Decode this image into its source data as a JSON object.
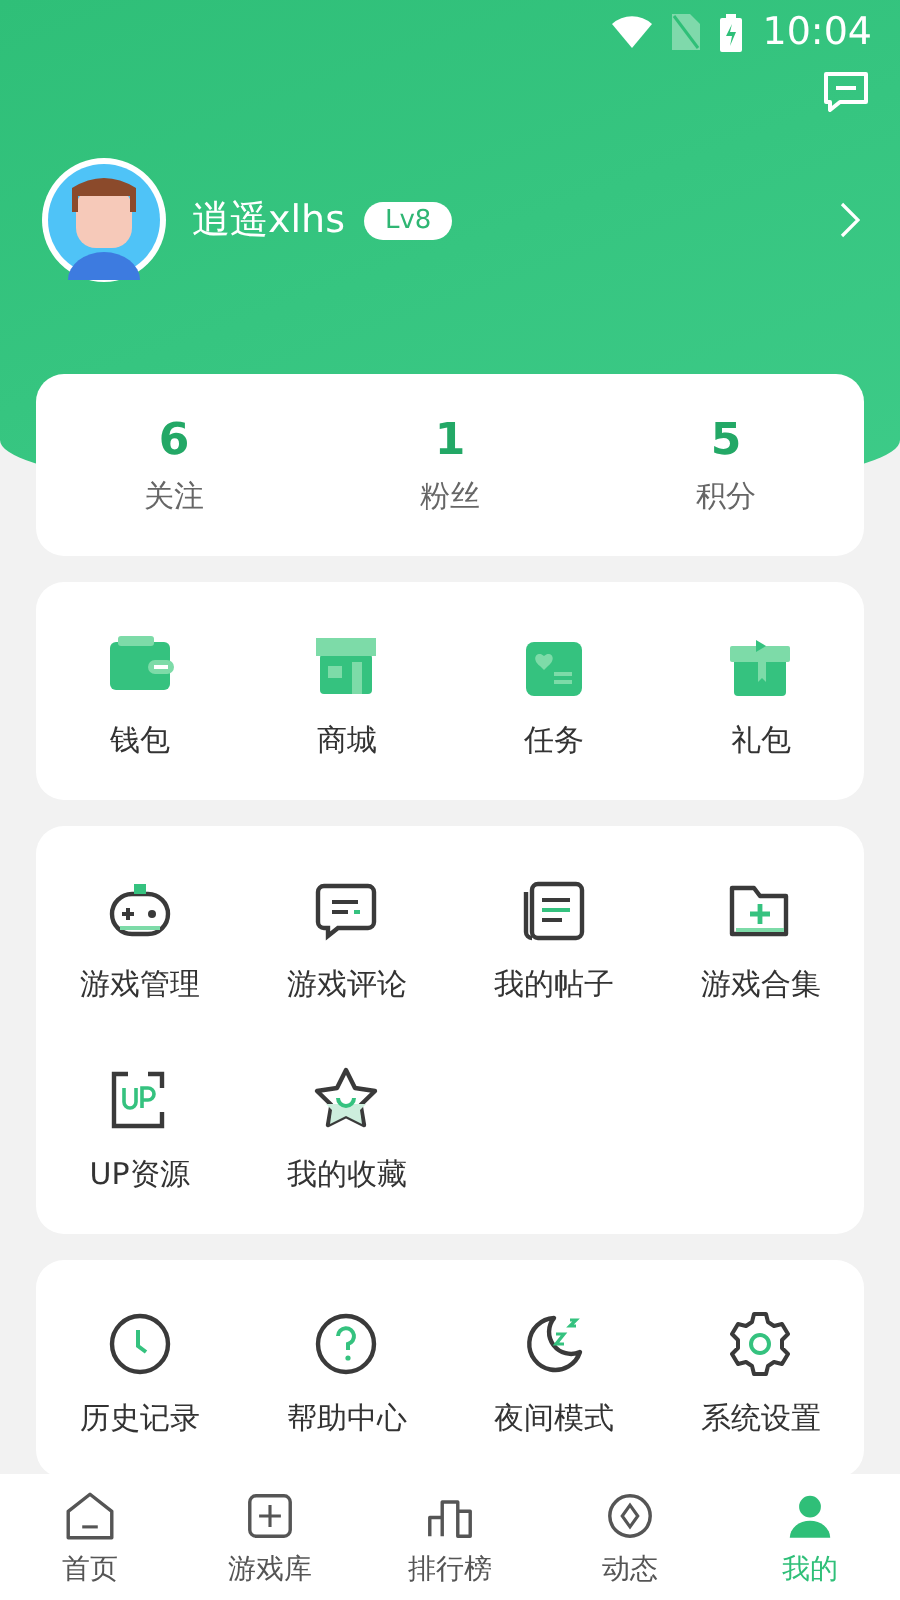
{
  "status_bar": {
    "time": "10:04"
  },
  "profile": {
    "name": "逍遥xlhs",
    "level": "Lv8"
  },
  "stats": [
    {
      "value": "6",
      "label": "关注"
    },
    {
      "value": "1",
      "label": "粉丝"
    },
    {
      "value": "5",
      "label": "积分"
    }
  ],
  "assets": [
    {
      "kind": "wallet",
      "label": "钱包"
    },
    {
      "kind": "shop",
      "label": "商城"
    },
    {
      "kind": "task",
      "label": "任务"
    },
    {
      "kind": "gift",
      "label": "礼包"
    }
  ],
  "tools": [
    {
      "kind": "gamepad",
      "label": "游戏管理"
    },
    {
      "kind": "comment",
      "label": "游戏评论"
    },
    {
      "kind": "post",
      "label": "我的帖子"
    },
    {
      "kind": "folder",
      "label": "游戏合集"
    },
    {
      "kind": "up",
      "label": "UP资源"
    },
    {
      "kind": "star",
      "label": "我的收藏"
    }
  ],
  "more": [
    {
      "kind": "clock",
      "label": "历史记录"
    },
    {
      "kind": "help",
      "label": "帮助中心"
    },
    {
      "kind": "moon",
      "label": "夜间模式"
    },
    {
      "kind": "gear",
      "label": "系统设置"
    }
  ],
  "bottom_nav": [
    {
      "kind": "home",
      "label": "首页",
      "selected": false
    },
    {
      "kind": "library",
      "label": "游戏库",
      "selected": false
    },
    {
      "kind": "rank",
      "label": "排行榜",
      "selected": false
    },
    {
      "kind": "feed",
      "label": "动态",
      "selected": false
    },
    {
      "kind": "me",
      "label": "我的",
      "selected": true
    }
  ]
}
